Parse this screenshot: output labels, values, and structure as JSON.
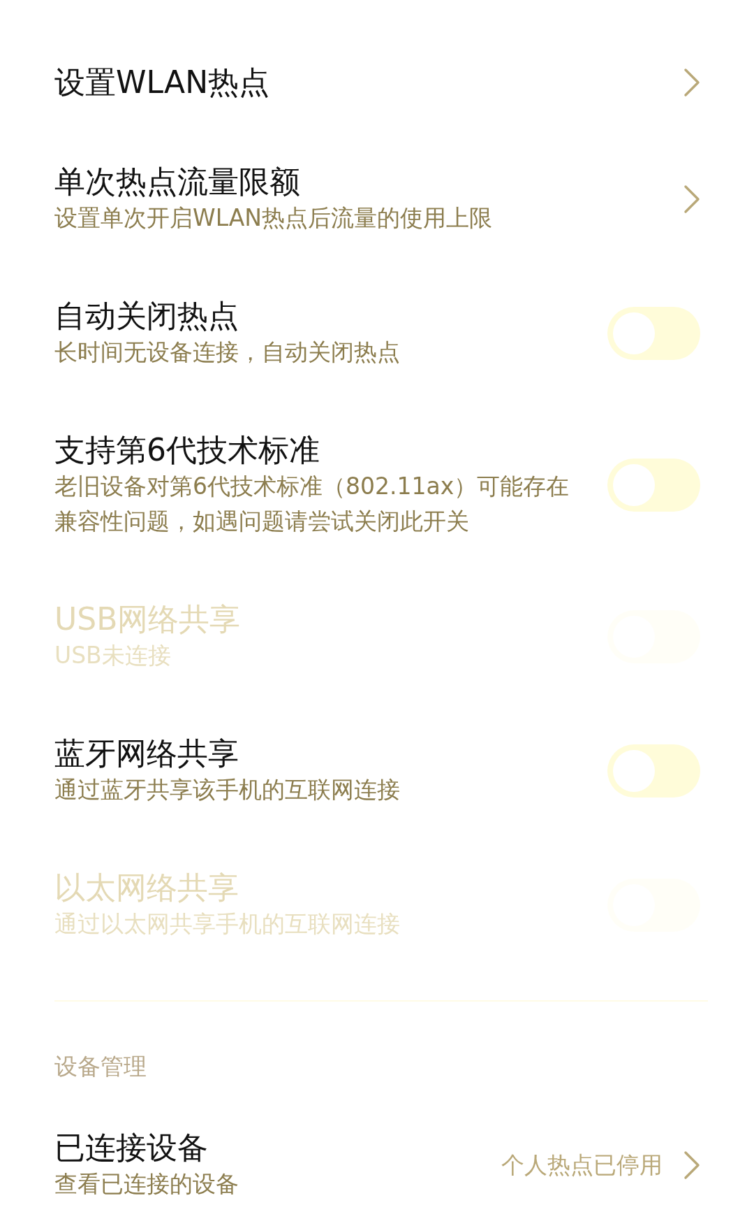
{
  "settings": [
    {
      "kind": "link",
      "title": "设置WLAN热点",
      "disabled": false
    },
    {
      "kind": "link",
      "title": "单次热点流量限额",
      "subtitle": "设置单次开启WLAN热点后流量的使用上限",
      "disabled": false
    },
    {
      "kind": "toggle",
      "title": "自动关闭热点",
      "subtitle": "长时间无设备连接，自动关闭热点",
      "on": false,
      "disabled": false
    },
    {
      "kind": "toggle",
      "title": "支持第6代技术标准",
      "subtitle": "老旧设备对第6代技术标准（802.11ax）可能存在兼容性问题，如遇问题请尝试关闭此开关",
      "on": false,
      "disabled": false
    },
    {
      "kind": "toggle",
      "title": "USB网络共享",
      "subtitle": "USB未连接",
      "on": false,
      "disabled": true
    },
    {
      "kind": "toggle",
      "title": "蓝牙网络共享",
      "subtitle": "通过蓝牙共享该手机的互联网连接",
      "on": false,
      "disabled": false
    },
    {
      "kind": "toggle",
      "title": "以太网络共享",
      "subtitle": "通过以太网共享手机的互联网连接",
      "on": false,
      "disabled": true
    }
  ],
  "device_section": {
    "header": "设备管理",
    "items": [
      {
        "kind": "link",
        "title": "已连接设备",
        "subtitle": "查看已连接的设备",
        "value": "个人热点已停用",
        "disabled": false
      }
    ]
  }
}
